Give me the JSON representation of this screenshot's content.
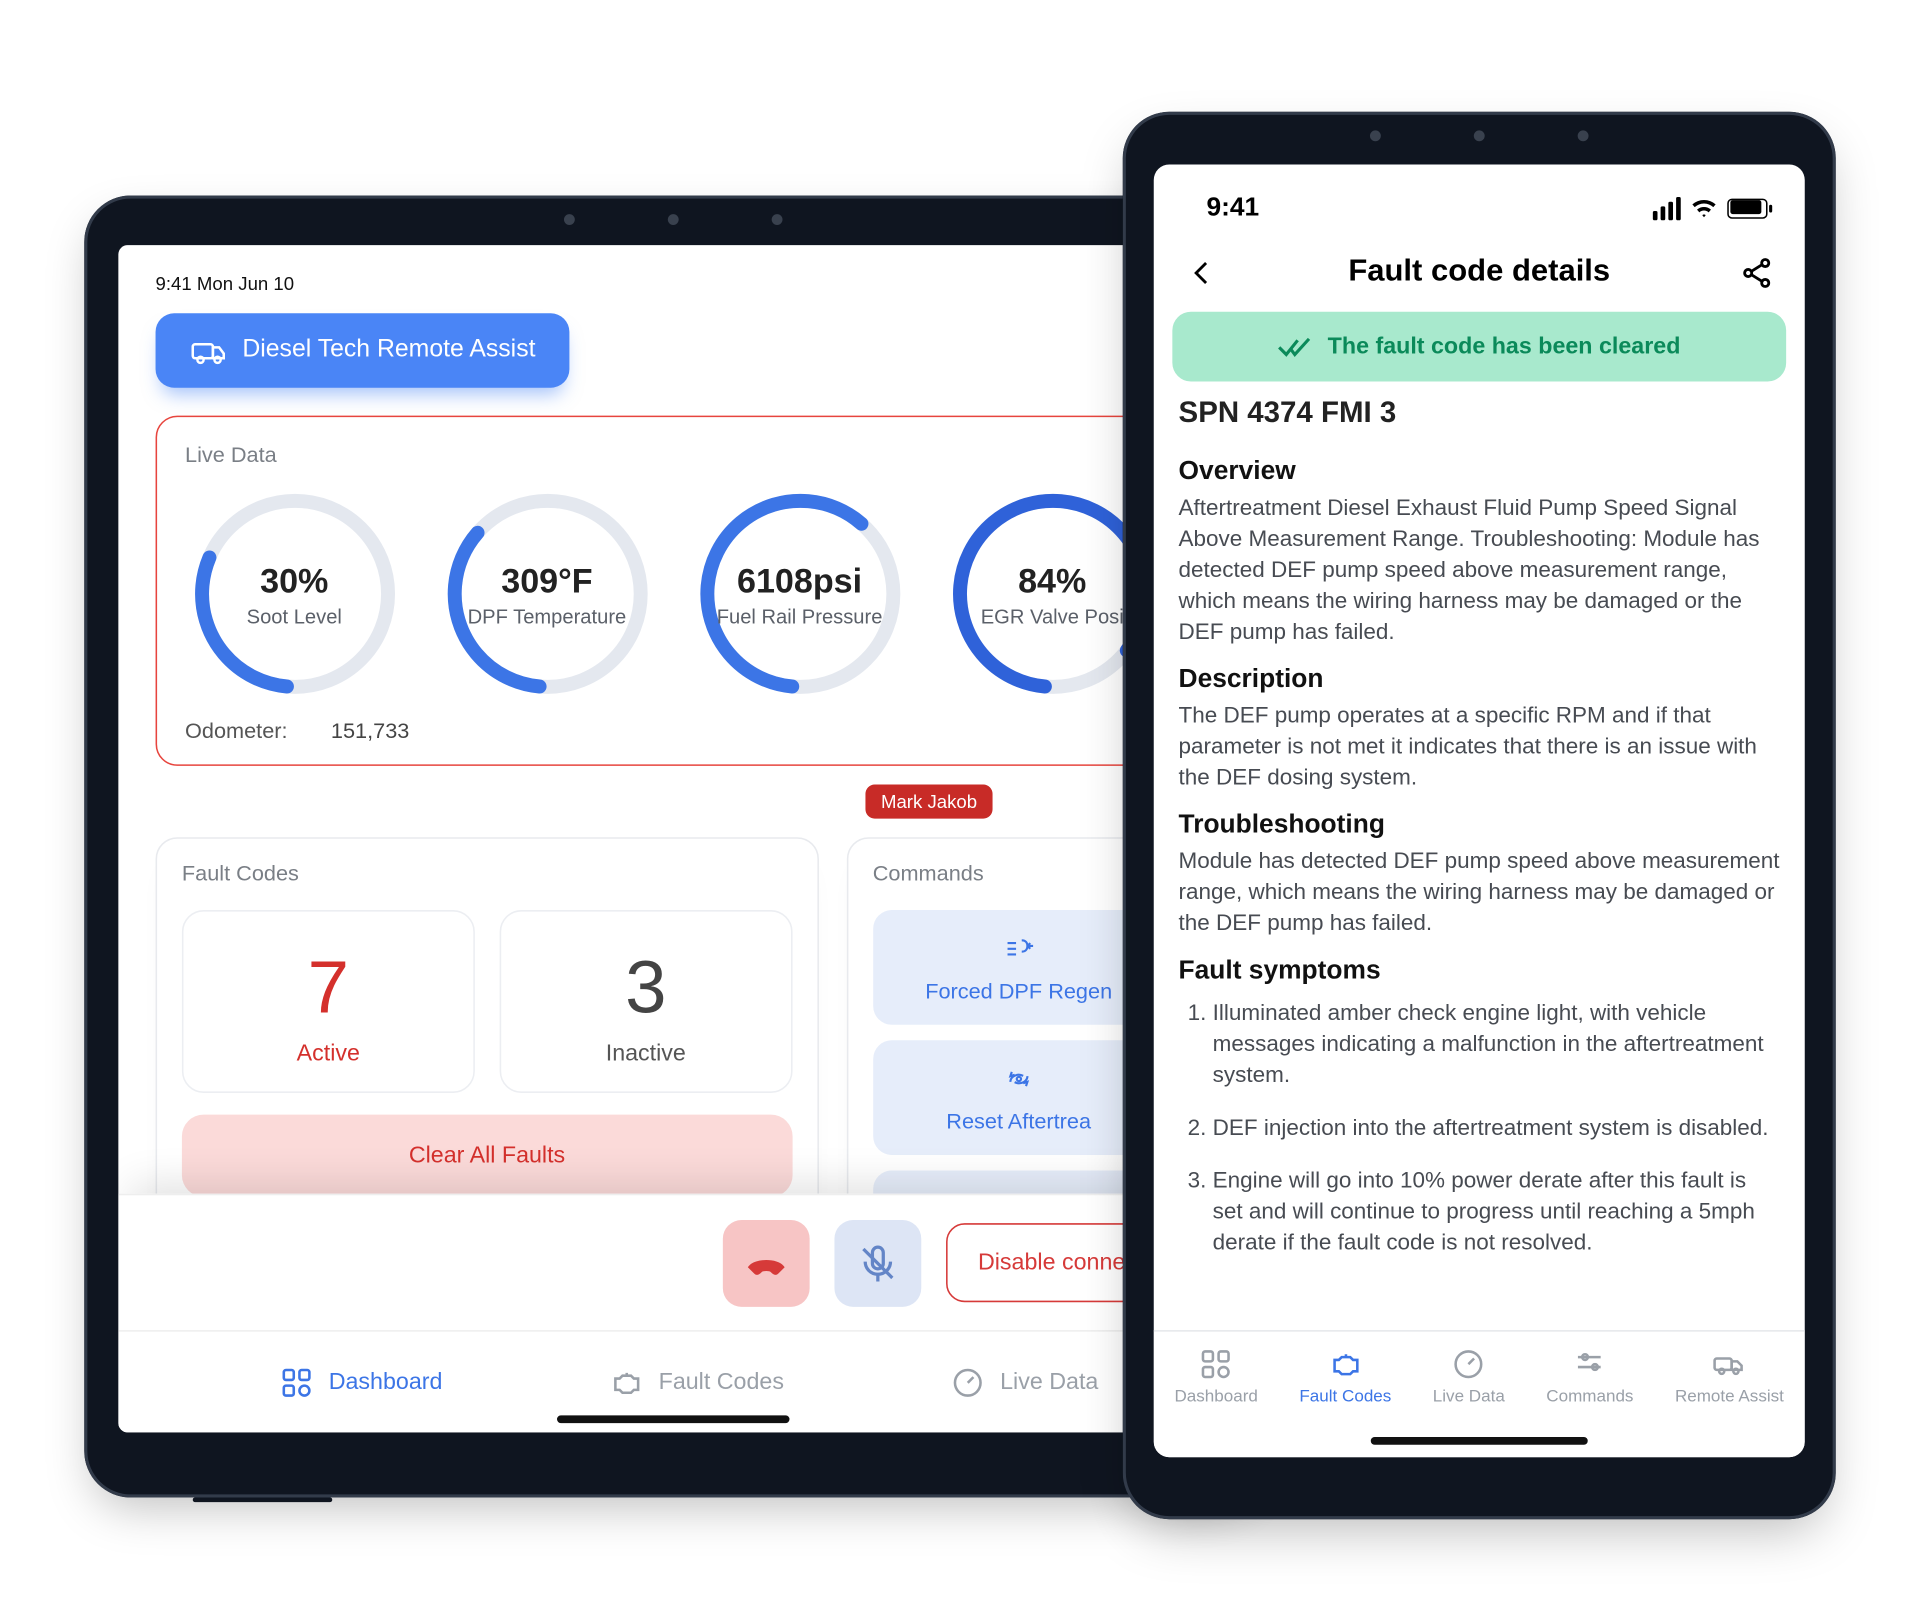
{
  "tablet": {
    "status_time": "9:41  Mon Jun 10",
    "assist_button": "Diesel Tech Remote Assist",
    "live": {
      "title": "Live Data",
      "gauges": [
        {
          "value": "30%",
          "label": "Soot Level",
          "pct": 30,
          "color": "#3c75e6"
        },
        {
          "value": "309°F",
          "label": "DPF Temperature",
          "pct": 35,
          "color": "#3c75e6"
        },
        {
          "value": "6108psi",
          "label": "Fuel Rail Pressure",
          "pct": 60,
          "color": "#3c75e6"
        },
        {
          "value": "84%",
          "label": "EGR Valve Posi",
          "pct": 84,
          "color": "#2f62d9"
        }
      ],
      "odometer_label": "Odometer:",
      "odometer_value": "151,733"
    },
    "cursor_name": "Mark Jakob",
    "faults": {
      "title": "Fault Codes",
      "active_n": "7",
      "active_t": "Active",
      "inactive_n": "3",
      "inactive_t": "Inactive",
      "clear": "Clear All Faults"
    },
    "commands": {
      "title": "Commands",
      "items": [
        "Forced DPF Regen",
        "Reset Aftertrea",
        "..."
      ]
    },
    "call": {
      "disable": "Disable connectio"
    },
    "tabs": [
      "Dashboard",
      "Fault Codes",
      "Live Data"
    ]
  },
  "phone": {
    "time": "9:41",
    "title": "Fault code details",
    "toast": "The fault code has been cleared",
    "spn": "SPN 4374 FMI 3",
    "overview_h": "Overview",
    "overview": "Aftertreatment Diesel Exhaust Fluid Pump Speed Signal Above Measurement Range. Troubleshooting: Module has detected DEF pump speed above measurement range, which means the wiring harness may be damaged or the DEF pump has failed.",
    "description_h": "Description",
    "description": "The DEF pump operates at a specific RPM and if that parameter is not met it indicates that there is an issue with the DEF dosing system.",
    "troubleshooting_h": "Troubleshooting",
    "troubleshooting": "Module has detected DEF pump speed above measurement range, which means the wiring harness may be damaged or the DEF pump has failed.",
    "symptoms_h": "Fault symptoms",
    "symptoms": [
      "Illuminated amber check engine light, with vehicle messages indicating a malfunction in the aftertreatment system.",
      "DEF injection into the aftertreatment system is disabled.",
      "Engine will go into 10% power derate after this fault is set and will continue to progress until reaching a 5mph derate if the fault code is not resolved."
    ],
    "tabs": [
      "Dashboard",
      "Fault Codes",
      "Live Data",
      "Commands",
      "Remote Assist"
    ]
  }
}
